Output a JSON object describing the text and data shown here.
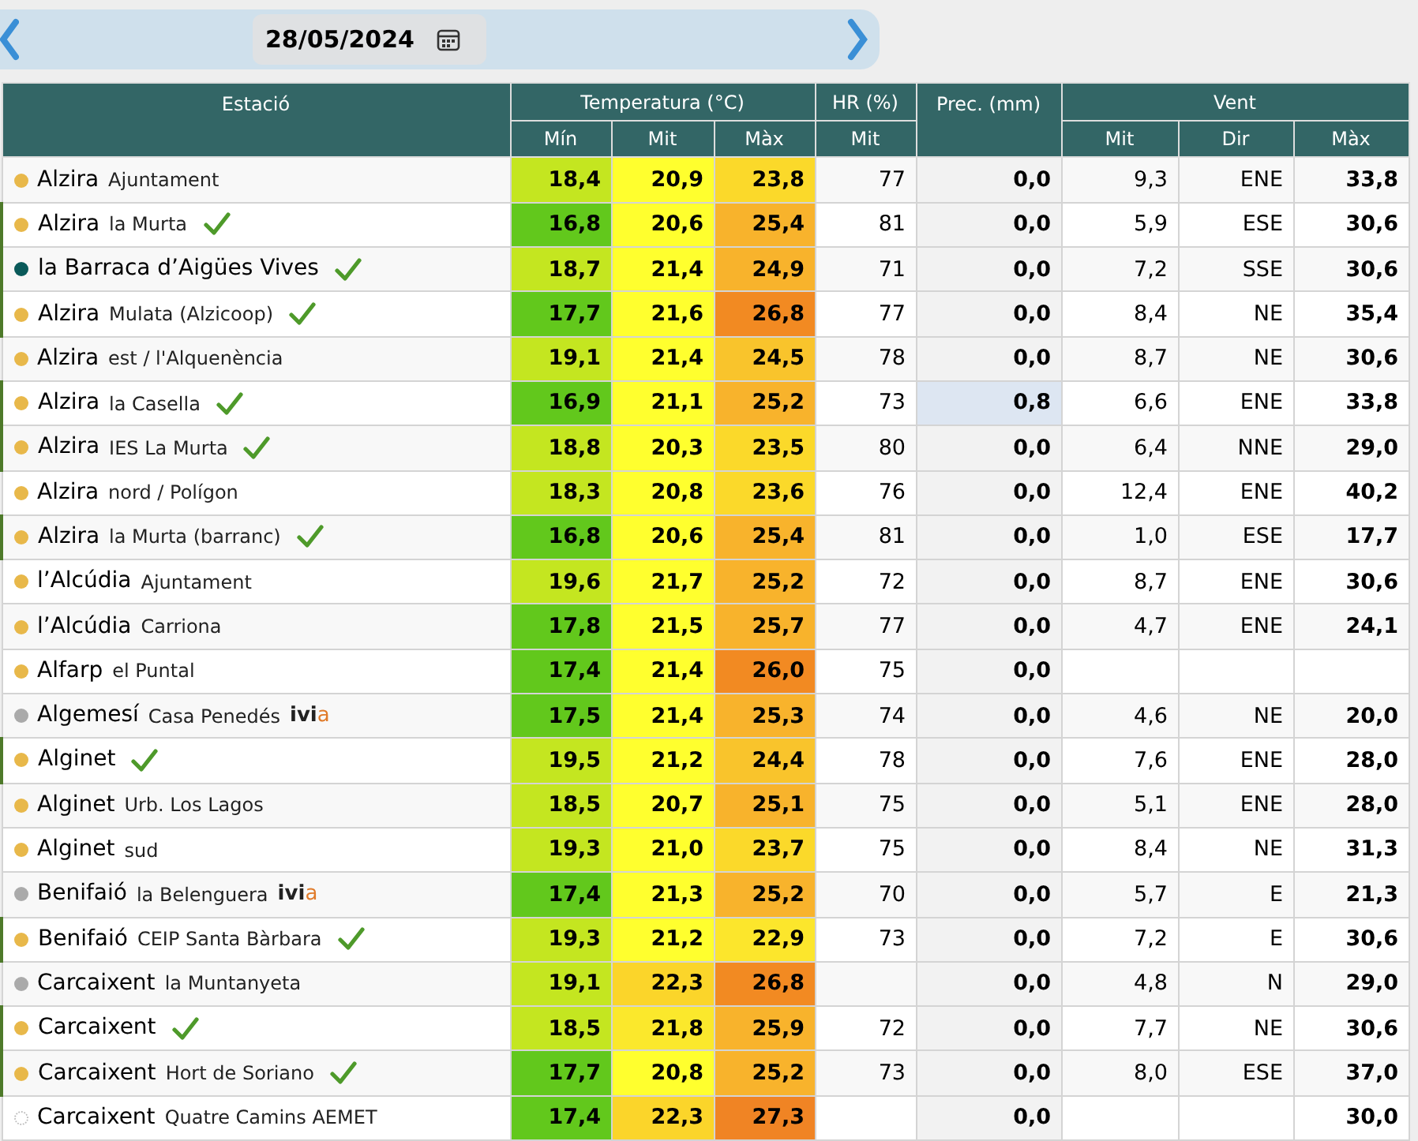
{
  "date_bar": {
    "date": "28/05/2024"
  },
  "header": {
    "groups": [
      "Estació",
      "Temperatura (°C)",
      "HR (%)",
      "Prec. (mm)",
      "Vent"
    ],
    "subs": [
      "Mín",
      "Mit",
      "Màx",
      "Mit",
      "Mit",
      "Dir",
      "Màx"
    ]
  },
  "rows": [
    {
      "town": "Alzira",
      "place": "Ajuntament",
      "dot": {
        "kind": "filled",
        "color": "#e8b84a"
      },
      "verified": false,
      "min": {
        "value": "18,4",
        "color": "#c4e620"
      },
      "mit": {
        "value": "20,9",
        "color": "#ffff2e"
      },
      "max": {
        "value": "23,8",
        "color": "#fbd92a"
      },
      "hr": "77",
      "prec": {
        "value": "0,0",
        "highlighted": false
      },
      "wind_mit": "9,3",
      "wind_dir": "ENE",
      "wind_max": "33,8"
    },
    {
      "town": "Alzira",
      "place": "la Murta",
      "dot": {
        "kind": "filled",
        "color": "#e8b84a"
      },
      "verified": true,
      "min": {
        "value": "16,8",
        "color": "#62c81c"
      },
      "mit": {
        "value": "20,6",
        "color": "#ffff2e"
      },
      "max": {
        "value": "25,4",
        "color": "#f8b32c"
      },
      "hr": "81",
      "prec": {
        "value": "0,0",
        "highlighted": false
      },
      "wind_mit": "5,9",
      "wind_dir": "ESE",
      "wind_max": "30,6"
    },
    {
      "town": "la Barraca d’Aigües Vives",
      "dot": {
        "kind": "filled",
        "color": "#0a5a5a"
      },
      "verified": true,
      "min": {
        "value": "18,7",
        "color": "#c4e620"
      },
      "mit": {
        "value": "21,4",
        "color": "#ffff2e"
      },
      "max": {
        "value": "24,9",
        "color": "#f8b32c"
      },
      "hr": "71",
      "prec": {
        "value": "0,0",
        "highlighted": false
      },
      "wind_mit": "7,2",
      "wind_dir": "SSE",
      "wind_max": "30,6"
    },
    {
      "town": "Alzira",
      "place": "Mulata (Alzicoop)",
      "dot": {
        "kind": "filled",
        "color": "#e8b84a"
      },
      "verified": true,
      "min": {
        "value": "17,7",
        "color": "#62c81c"
      },
      "mit": {
        "value": "21,6",
        "color": "#ffff2e"
      },
      "max": {
        "value": "26,8",
        "color": "#f28a22"
      },
      "hr": "77",
      "prec": {
        "value": "0,0",
        "highlighted": false
      },
      "wind_mit": "8,4",
      "wind_dir": "NE",
      "wind_max": "35,4"
    },
    {
      "town": "Alzira",
      "place": "est / l'Alquenència",
      "dot": {
        "kind": "filled",
        "color": "#e8b84a"
      },
      "verified": false,
      "min": {
        "value": "19,1",
        "color": "#c4e620"
      },
      "mit": {
        "value": "21,4",
        "color": "#ffff2e"
      },
      "max": {
        "value": "24,5",
        "color": "#f9c42c"
      },
      "hr": "78",
      "prec": {
        "value": "0,0",
        "highlighted": false
      },
      "wind_mit": "8,7",
      "wind_dir": "NE",
      "wind_max": "30,6"
    },
    {
      "town": "Alzira",
      "place": "la Casella",
      "dot": {
        "kind": "filled",
        "color": "#e8b84a"
      },
      "verified": true,
      "min": {
        "value": "16,9",
        "color": "#62c81c"
      },
      "mit": {
        "value": "21,1",
        "color": "#ffff2e"
      },
      "max": {
        "value": "25,2",
        "color": "#f8b32c"
      },
      "hr": "73",
      "prec": {
        "value": "0,8",
        "highlighted": true
      },
      "wind_mit": "6,6",
      "wind_dir": "ENE",
      "wind_max": "33,8"
    },
    {
      "town": "Alzira",
      "place": "IES La Murta",
      "dot": {
        "kind": "filled",
        "color": "#e8b84a"
      },
      "verified": true,
      "min": {
        "value": "18,8",
        "color": "#c4e620"
      },
      "mit": {
        "value": "20,3",
        "color": "#ffff2e"
      },
      "max": {
        "value": "23,5",
        "color": "#fbd92a"
      },
      "hr": "80",
      "prec": {
        "value": "0,0",
        "highlighted": false
      },
      "wind_mit": "6,4",
      "wind_dir": "NNE",
      "wind_max": "29,0"
    },
    {
      "town": "Alzira",
      "place": "nord / Polígon",
      "dot": {
        "kind": "filled",
        "color": "#e8b84a"
      },
      "verified": false,
      "min": {
        "value": "18,3",
        "color": "#c4e620"
      },
      "mit": {
        "value": "20,8",
        "color": "#ffff2e"
      },
      "max": {
        "value": "23,6",
        "color": "#fbd92a"
      },
      "hr": "76",
      "prec": {
        "value": "0,0",
        "highlighted": false
      },
      "wind_mit": "12,4",
      "wind_dir": "ENE",
      "wind_max": "40,2"
    },
    {
      "town": "Alzira",
      "place": "la Murta (barranc)",
      "dot": {
        "kind": "filled",
        "color": "#e8b84a"
      },
      "verified": true,
      "min": {
        "value": "16,8",
        "color": "#62c81c"
      },
      "mit": {
        "value": "20,6",
        "color": "#ffff2e"
      },
      "max": {
        "value": "25,4",
        "color": "#f8b32c"
      },
      "hr": "81",
      "prec": {
        "value": "0,0",
        "highlighted": false
      },
      "wind_mit": "1,0",
      "wind_dir": "ESE",
      "wind_max": "17,7"
    },
    {
      "town": "l’Alcúdia",
      "place": "Ajuntament",
      "dot": {
        "kind": "filled",
        "color": "#e8b84a"
      },
      "verified": false,
      "min": {
        "value": "19,6",
        "color": "#c4e620"
      },
      "mit": {
        "value": "21,7",
        "color": "#ffff2e"
      },
      "max": {
        "value": "25,2",
        "color": "#f8b32c"
      },
      "hr": "72",
      "prec": {
        "value": "0,0",
        "highlighted": false
      },
      "wind_mit": "8,7",
      "wind_dir": "ENE",
      "wind_max": "30,6"
    },
    {
      "town": "l’Alcúdia",
      "place": "Carriona",
      "dot": {
        "kind": "filled",
        "color": "#e8b84a"
      },
      "verified": false,
      "min": {
        "value": "17,8",
        "color": "#62c81c"
      },
      "mit": {
        "value": "21,5",
        "color": "#ffff2e"
      },
      "max": {
        "value": "25,7",
        "color": "#f8b32c"
      },
      "hr": "77",
      "prec": {
        "value": "0,0",
        "highlighted": false
      },
      "wind_mit": "4,7",
      "wind_dir": "ENE",
      "wind_max": "24,1"
    },
    {
      "town": "Alfarp",
      "place": "el Puntal",
      "dot": {
        "kind": "filled",
        "color": "#e8b84a"
      },
      "verified": false,
      "min": {
        "value": "17,4",
        "color": "#62c81c"
      },
      "mit": {
        "value": "21,4",
        "color": "#ffff2e"
      },
      "max": {
        "value": "26,0",
        "color": "#f28a22"
      },
      "hr": "75",
      "prec": {
        "value": "0,0",
        "highlighted": false
      }
    },
    {
      "town": "Algemesí",
      "place": "Casa Penedés",
      "logo": {
        "main": "ivi",
        "accent": "a"
      },
      "dot": {
        "kind": "filled",
        "color": "#aaaaaa"
      },
      "verified": false,
      "min": {
        "value": "17,5",
        "color": "#62c81c"
      },
      "mit": {
        "value": "21,4",
        "color": "#ffff2e"
      },
      "max": {
        "value": "25,3",
        "color": "#f8b32c"
      },
      "hr": "74",
      "prec": {
        "value": "0,0",
        "highlighted": false
      },
      "wind_mit": "4,6",
      "wind_dir": "NE",
      "wind_max": "20,0"
    },
    {
      "town": "Alginet",
      "dot": {
        "kind": "filled",
        "color": "#e8b84a"
      },
      "verified": true,
      "min": {
        "value": "19,5",
        "color": "#c4e620"
      },
      "mit": {
        "value": "21,2",
        "color": "#ffff2e"
      },
      "max": {
        "value": "24,4",
        "color": "#f9c42c"
      },
      "hr": "78",
      "prec": {
        "value": "0,0",
        "highlighted": false
      },
      "wind_mit": "7,6",
      "wind_dir": "ENE",
      "wind_max": "28,0"
    },
    {
      "town": "Alginet",
      "place": "Urb. Los Lagos",
      "dot": {
        "kind": "filled",
        "color": "#e8b84a"
      },
      "verified": false,
      "min": {
        "value": "18,5",
        "color": "#c4e620"
      },
      "mit": {
        "value": "20,7",
        "color": "#ffff2e"
      },
      "max": {
        "value": "25,1",
        "color": "#f8b32c"
      },
      "hr": "75",
      "prec": {
        "value": "0,0",
        "highlighted": false
      },
      "wind_mit": "5,1",
      "wind_dir": "ENE",
      "wind_max": "28,0"
    },
    {
      "town": "Alginet",
      "place": "sud",
      "dot": {
        "kind": "filled",
        "color": "#e8b84a"
      },
      "verified": false,
      "min": {
        "value": "19,3",
        "color": "#c4e620"
      },
      "mit": {
        "value": "21,0",
        "color": "#ffff2e"
      },
      "max": {
        "value": "23,7",
        "color": "#fbd92a"
      },
      "hr": "75",
      "prec": {
        "value": "0,0",
        "highlighted": false
      },
      "wind_mit": "8,4",
      "wind_dir": "NE",
      "wind_max": "31,3"
    },
    {
      "town": "Benifaió",
      "place": "la Belenguera",
      "logo": {
        "main": "ivi",
        "accent": "a"
      },
      "dot": {
        "kind": "filled",
        "color": "#aaaaaa"
      },
      "verified": false,
      "min": {
        "value": "17,4",
        "color": "#62c81c"
      },
      "mit": {
        "value": "21,3",
        "color": "#ffff2e"
      },
      "max": {
        "value": "25,2",
        "color": "#f8b32c"
      },
      "hr": "70",
      "prec": {
        "value": "0,0",
        "highlighted": false
      },
      "wind_mit": "5,7",
      "wind_dir": "E",
      "wind_max": "21,3"
    },
    {
      "town": "Benifaió",
      "place": "CEIP Santa Bàrbara",
      "dot": {
        "kind": "filled",
        "color": "#e8b84a"
      },
      "verified": true,
      "min": {
        "value": "19,3",
        "color": "#c4e620"
      },
      "mit": {
        "value": "21,2",
        "color": "#ffff2e"
      },
      "max": {
        "value": "22,9",
        "color": "#fce62c"
      },
      "hr": "73",
      "prec": {
        "value": "0,0",
        "highlighted": false
      },
      "wind_mit": "7,2",
      "wind_dir": "E",
      "wind_max": "30,6"
    },
    {
      "town": "Carcaixent",
      "place": "la Muntanyeta",
      "dot": {
        "kind": "filled",
        "color": "#aaaaaa"
      },
      "verified": false,
      "min": {
        "value": "19,1",
        "color": "#c4e620"
      },
      "mit": {
        "value": "22,3",
        "color": "#fbd52a"
      },
      "max": {
        "value": "26,8",
        "color": "#f28a22"
      },
      "prec": {
        "value": "0,0",
        "highlighted": false
      },
      "wind_mit": "4,8",
      "wind_dir": "N",
      "wind_max": "29,0"
    },
    {
      "town": "Carcaixent",
      "dot": {
        "kind": "filled",
        "color": "#e8b84a"
      },
      "verified": true,
      "min": {
        "value": "18,5",
        "color": "#c4e620"
      },
      "mit": {
        "value": "21,8",
        "color": "#fbe82c"
      },
      "max": {
        "value": "25,9",
        "color": "#f8b32c"
      },
      "hr": "72",
      "prec": {
        "value": "0,0",
        "highlighted": false
      },
      "wind_mit": "7,7",
      "wind_dir": "NE",
      "wind_max": "30,6"
    },
    {
      "town": "Carcaixent",
      "place": "Hort de Soriano",
      "dot": {
        "kind": "filled",
        "color": "#e8b84a"
      },
      "verified": true,
      "min": {
        "value": "17,7",
        "color": "#62c81c"
      },
      "mit": {
        "value": "20,8",
        "color": "#ffff2e"
      },
      "max": {
        "value": "25,2",
        "color": "#f8b32c"
      },
      "hr": "73",
      "prec": {
        "value": "0,0",
        "highlighted": false
      },
      "wind_mit": "8,0",
      "wind_dir": "ESE",
      "wind_max": "37,0"
    },
    {
      "town": "Carcaixent",
      "place": "Quatre Camins AEMET",
      "dot": {
        "kind": "outline",
        "color": "#bbbbbb"
      },
      "verified": false,
      "min": {
        "value": "17,4",
        "color": "#62c81c"
      },
      "mit": {
        "value": "22,3",
        "color": "#fbd52a"
      },
      "max": {
        "value": "27,3",
        "color": "#f08424"
      },
      "prec": {
        "value": "0,0",
        "highlighted": false
      },
      "wind_max": "30,0"
    }
  ]
}
